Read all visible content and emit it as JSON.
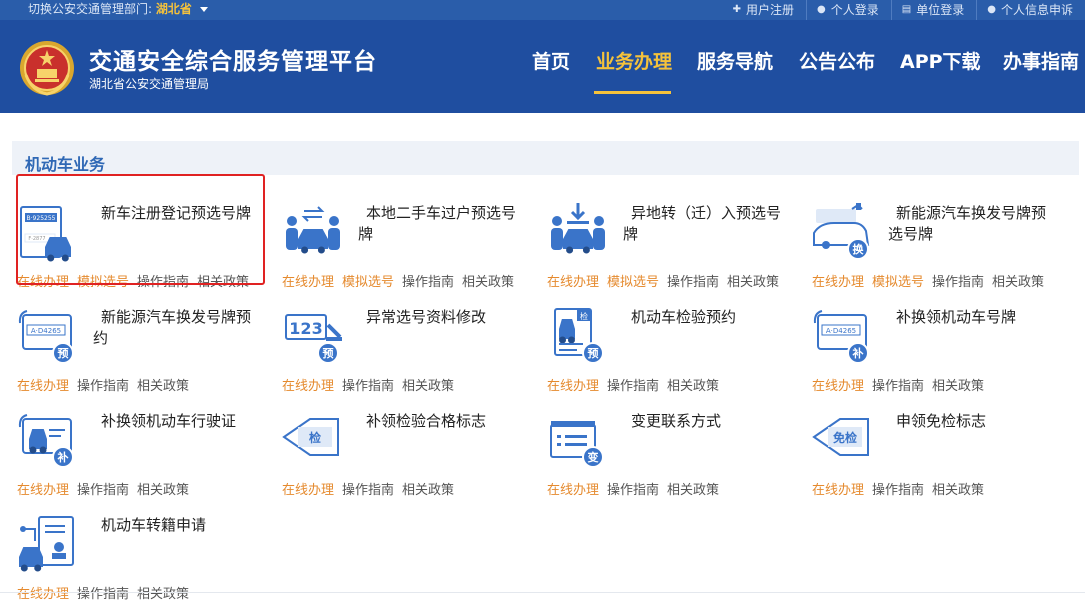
{
  "topbar": {
    "region_prefix": "切换公安交通管理部门:",
    "region_value": "湖北省",
    "links": [
      {
        "label": "用户注册",
        "icon": "plus-icon"
      },
      {
        "label": "个人登录",
        "icon": "person-icon"
      },
      {
        "label": "单位登录",
        "icon": "building-icon"
      },
      {
        "label": "个人信息申诉",
        "icon": "person-icon"
      }
    ]
  },
  "header": {
    "title": "交通安全综合服务管理平台",
    "subtitle": "湖北省公安交通管理局",
    "nav": [
      "首页",
      "业务办理",
      "服务导航",
      "公告公布",
      "APP下载",
      "办事指南"
    ],
    "active_nav": "业务办理"
  },
  "section": {
    "title": "机动车业务"
  },
  "colors": {
    "brand_blue": "#1f4ea0",
    "accent_orange": "#e58a2e",
    "active_nav_yellow": "#f5c23b"
  },
  "cards": [
    {
      "title": "新车注册登记预选号牌",
      "icon": "plate-car-icon",
      "badge": "",
      "actions": [
        "在线办理",
        "模拟选号",
        "操作指南",
        "相关政策"
      ],
      "plate_text": "B·925255",
      "plate_text2": "F·2877"
    },
    {
      "title": "本地二手车过户预选号牌",
      "icon": "transfer-car-icon",
      "badge": "",
      "actions": [
        "在线办理",
        "模拟选号",
        "操作指南",
        "相关政策"
      ]
    },
    {
      "title": "异地转（迁）入预选号牌",
      "icon": "migrate-car-icon",
      "badge": "",
      "actions": [
        "在线办理",
        "模拟选号",
        "操作指南",
        "相关政策"
      ]
    },
    {
      "title": "新能源汽车换发号牌预选号牌",
      "icon": "ev-car-icon",
      "badge": "换",
      "actions": [
        "在线办理",
        "模拟选号",
        "操作指南",
        "相关政策"
      ]
    },
    {
      "title": "新能源汽车换发号牌预约",
      "icon": "plate-reserve-icon",
      "badge": "预",
      "actions": [
        "在线办理",
        "操作指南",
        "相关政策"
      ],
      "plate_text": "A·D4265"
    },
    {
      "title": "异常选号资料修改",
      "icon": "number-edit-icon",
      "badge": "预",
      "actions": [
        "在线办理",
        "操作指南",
        "相关政策"
      ],
      "plate_text": "123"
    },
    {
      "title": "机动车检验预约",
      "icon": "inspection-doc-icon",
      "badge": "预",
      "actions": [
        "在线办理",
        "操作指南",
        "相关政策"
      ],
      "plate_text": "检"
    },
    {
      "title": "补换领机动车号牌",
      "icon": "plate-replace-icon",
      "badge": "补",
      "actions": [
        "在线办理",
        "操作指南",
        "相关政策"
      ],
      "plate_text": "A·D4265"
    },
    {
      "title": "补换领机动车行驶证",
      "icon": "license-replace-icon",
      "badge": "补",
      "actions": [
        "在线办理",
        "操作指南",
        "相关政策"
      ]
    },
    {
      "title": "补领检验合格标志",
      "icon": "inspection-tag-icon",
      "badge": "",
      "actions": [
        "在线办理",
        "操作指南",
        "相关政策"
      ],
      "plate_text": "检"
    },
    {
      "title": "变更联系方式",
      "icon": "contact-change-icon",
      "badge": "变",
      "actions": [
        "在线办理",
        "操作指南",
        "相关政策"
      ]
    },
    {
      "title": "申领免检标志",
      "icon": "exempt-tag-icon",
      "badge": "",
      "actions": [
        "在线办理",
        "操作指南",
        "相关政策"
      ],
      "plate_text": "免检"
    },
    {
      "title": "机动车转籍申请",
      "icon": "transfer-register-icon",
      "badge": "",
      "actions": [
        "在线办理",
        "操作指南",
        "相关政策"
      ]
    }
  ]
}
